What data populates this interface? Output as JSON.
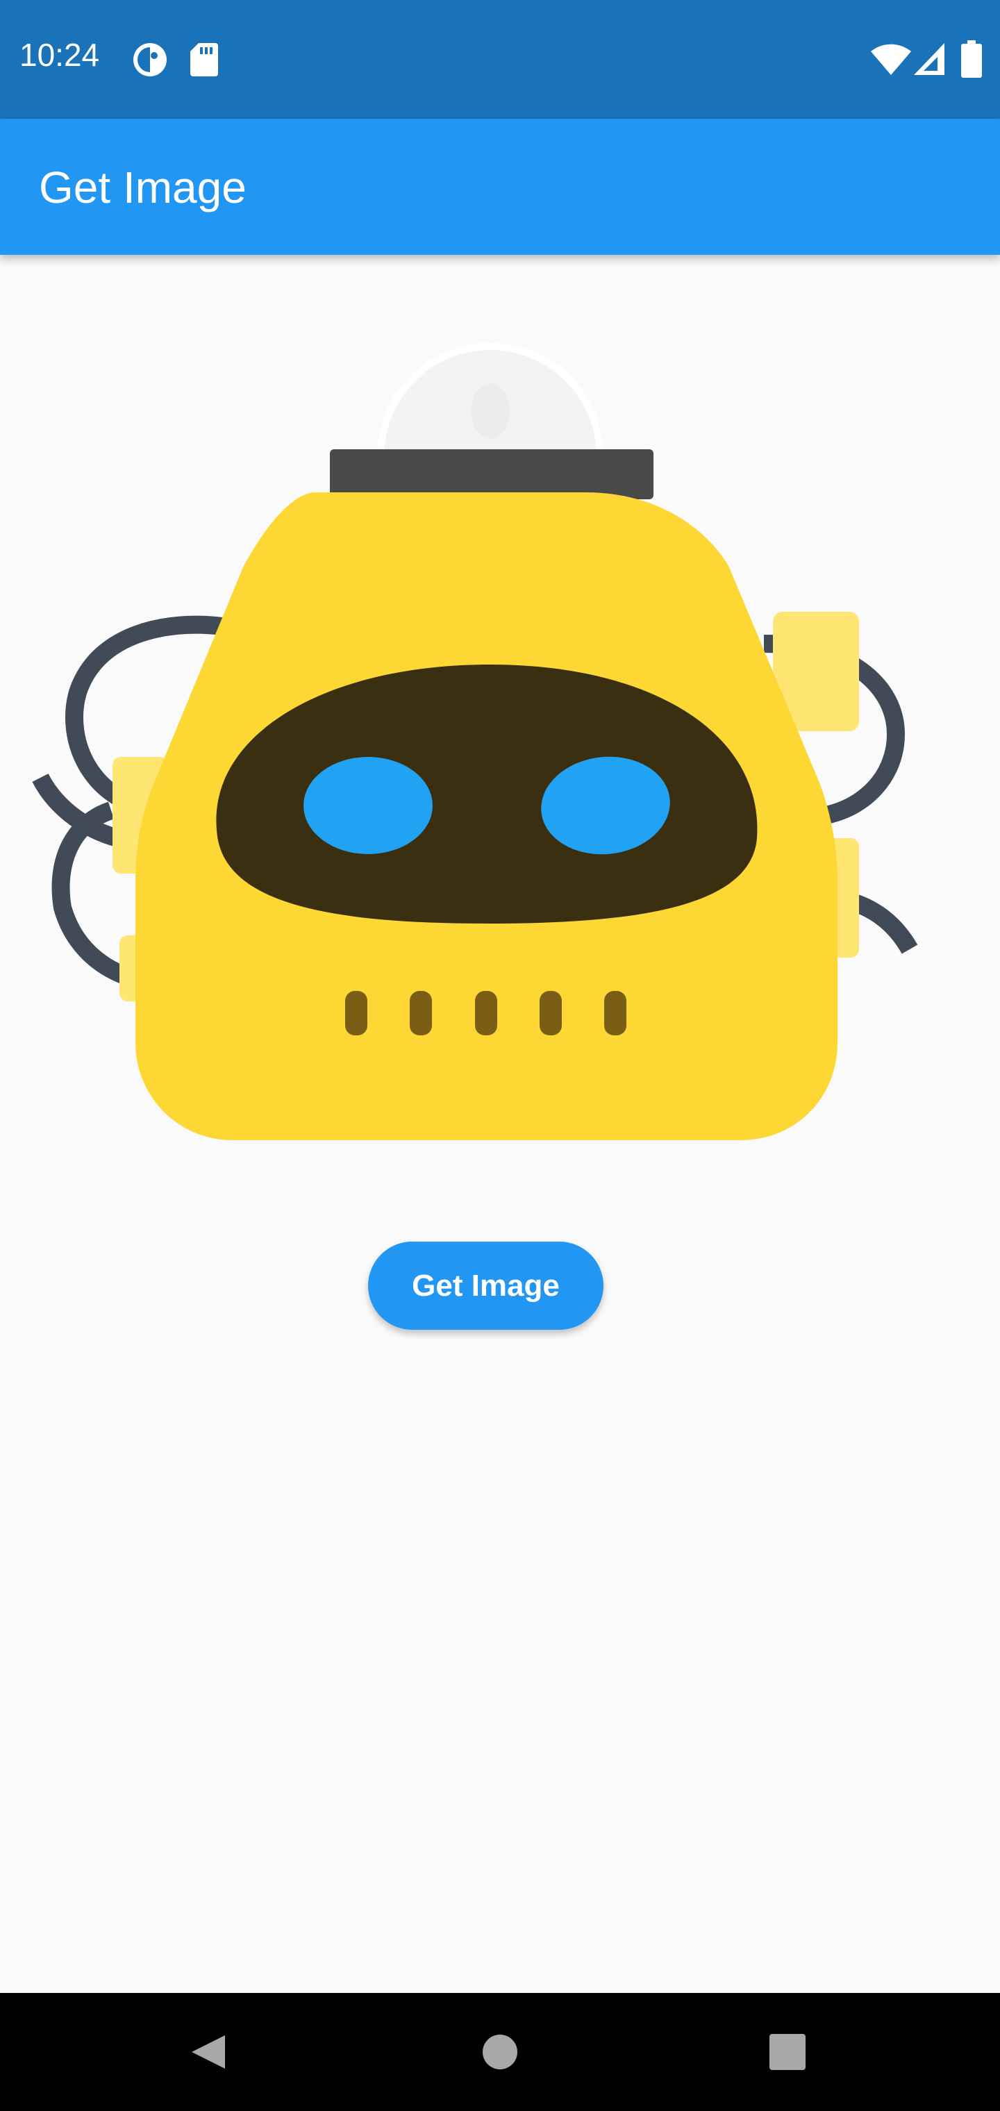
{
  "status_bar": {
    "time": "10:24",
    "left_icons": [
      "data-saver-icon",
      "sd-card-icon"
    ],
    "right_icons": [
      "wifi-icon",
      "cellular-signal-icon",
      "battery-icon"
    ],
    "background_color": "#1a72b8"
  },
  "app_bar": {
    "title": "Get Image",
    "background_color": "#2196f3"
  },
  "main": {
    "image": {
      "icon": "robot-illustration",
      "colors": {
        "body": "#fdd835",
        "face": "#3a2f10",
        "eyes": "#22a2f2",
        "limbs": "#414a57",
        "patches": "#ffe571",
        "antenna_base": "#4a4a4a"
      }
    },
    "button": {
      "label": "Get Image",
      "color": "#2196f3"
    }
  },
  "nav_bar": {
    "buttons": [
      "back-icon",
      "home-icon",
      "recents-icon"
    ]
  }
}
